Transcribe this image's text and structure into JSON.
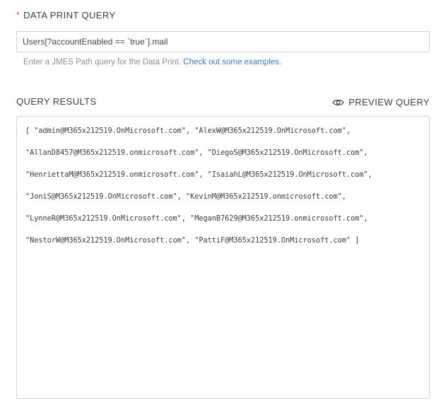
{
  "query_section": {
    "required_marker": "*",
    "label": "DATA PRINT QUERY",
    "input_value": "Users[?accountEnabled == `true`].mail",
    "help_text": "Enter a JMES Path query for the Data Print. ",
    "help_link": "Check out some examples."
  },
  "results_section": {
    "label": "QUERY RESULTS",
    "preview_label": "PREVIEW QUERY",
    "preview_icon": "eye-icon",
    "lines": [
      "[ \"admin@M365x212519.OnMicrosoft.com\", \"AlexW@M365x212519.OnMicrosoft.com\",",
      "\"AllanD8457@M365x212519.onmicrosoft.com\", \"DiegoS@M365x212519.OnMicrosoft.com\",",
      "\"HenriettaM@M365x212519.onmicrosoft.com\", \"IsaiahL@M365x212519.OnMicrosoft.com\",",
      "\"JoniS@M365x212519.OnMicrosoft.com\", \"KevinM@M365x212519.onmicrosoft.com\",",
      "\"LynneR@M365x212519.OnMicrosoft.com\", \"MeganB7629@M365x212519.onmicrosoft.com\",",
      "\"NestorW@M365x212519.OnMicrosoft.com\", \"PattiF@M365x212519.OnMicrosoft.com\" ]"
    ]
  },
  "colors": {
    "required": "#e0453a",
    "link": "#2f80c8",
    "border": "#cfd3d7",
    "muted_text": "#8a8f94"
  }
}
